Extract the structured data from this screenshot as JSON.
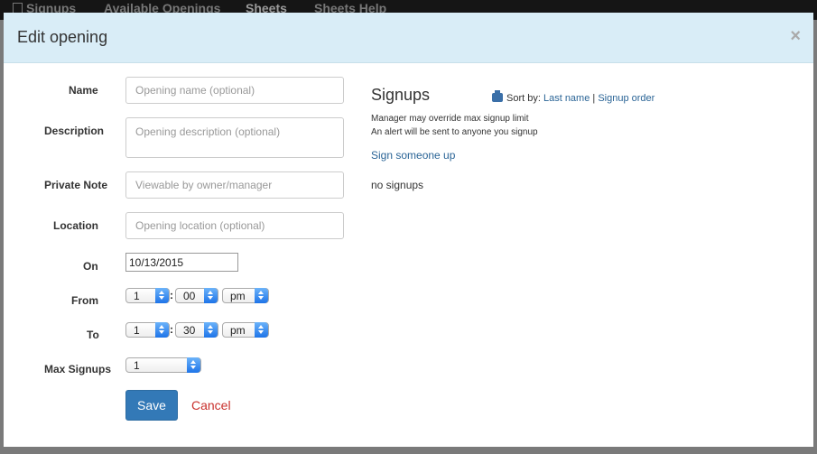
{
  "nav": {
    "signups": "Signups",
    "available_openings": "Available Openings",
    "sheets": "Sheets",
    "sheets_help": "Sheets Help"
  },
  "modal": {
    "title": "Edit opening",
    "close": "×"
  },
  "form": {
    "name_label": "Name",
    "name_placeholder": "Opening name (optional)",
    "description_label": "Description",
    "description_placeholder": "Opening description (optional)",
    "private_note_label": "Private Note",
    "private_note_placeholder": "Viewable by owner/manager",
    "location_label": "Location",
    "location_placeholder": "Opening location (optional)",
    "on_label": "On",
    "on_value": "10/13/2015",
    "from_label": "From",
    "from_hour": "1",
    "from_minute": "00",
    "from_ampm": "pm",
    "to_label": "To",
    "to_hour": "1",
    "to_minute": "30",
    "to_ampm": "pm",
    "colon": ":",
    "max_signups_label": "Max Signups",
    "max_signups_value": "1",
    "save": "Save",
    "cancel": "Cancel"
  },
  "signups": {
    "title": "Signups",
    "sort_by": "Sort by:",
    "sort_last_name": "Last name",
    "separator": "|",
    "sort_signup_order": "Signup order",
    "note_override": "Manager may override max signup limit",
    "note_alert": "An alert will be sent to anyone you signup",
    "sign_someone_up": "Sign someone up",
    "empty": "no signups"
  },
  "colors": {
    "header_bg": "#d9edf7",
    "primary": "#3379b7",
    "cancel": "#c9302c",
    "link": "#2a6496"
  }
}
